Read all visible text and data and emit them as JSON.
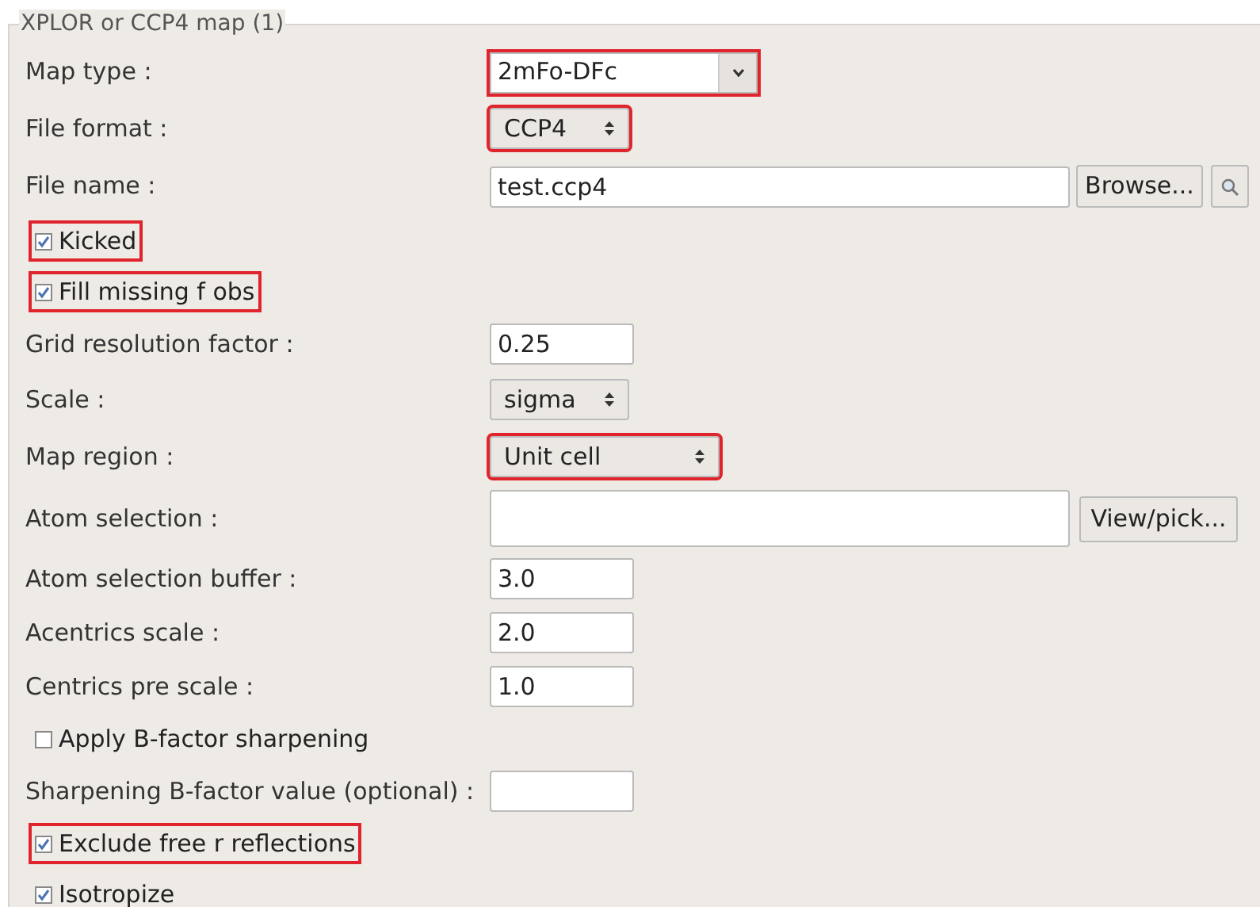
{
  "group": {
    "title": "XPLOR or CCP4 map (1)"
  },
  "rows": [
    {
      "kind": "combo",
      "label": "Map type :",
      "value": "2mFo-DFc",
      "highlighted": true
    },
    {
      "kind": "select",
      "label": "File format :",
      "value": "CCP4",
      "highlighted": true
    },
    {
      "kind": "file",
      "label": "File name :",
      "value": "test.ccp4",
      "button": "Browse...",
      "highlighted": false
    },
    {
      "kind": "checkbox",
      "label": "Kicked",
      "checked": true,
      "highlighted": true
    },
    {
      "kind": "checkbox",
      "label": "Fill missing f obs",
      "checked": true,
      "highlighted": true
    },
    {
      "kind": "text",
      "label": "Grid resolution factor :",
      "value": "0.25",
      "highlighted": false
    },
    {
      "kind": "select",
      "label": "Scale :",
      "value": "sigma",
      "highlighted": false
    },
    {
      "kind": "select_wide",
      "label": "Map region :",
      "value": "Unit cell",
      "highlighted": true
    },
    {
      "kind": "pick",
      "label": "Atom selection :",
      "button": "View/pick...",
      "highlighted": false
    },
    {
      "kind": "text",
      "label": "Atom selection buffer :",
      "value": "3.0",
      "highlighted": false
    },
    {
      "kind": "text",
      "label": "Acentrics scale :",
      "value": "2.0",
      "highlighted": false
    },
    {
      "kind": "text",
      "label": "Centrics pre scale :",
      "value": "1.0",
      "highlighted": false
    },
    {
      "kind": "checkbox",
      "label": "Apply B-factor sharpening",
      "checked": false,
      "highlighted": false
    },
    {
      "kind": "text",
      "label": "Sharpening B-factor value (optional) :",
      "highlighted": false
    },
    {
      "kind": "checkbox",
      "label": "Exclude free r reflections",
      "checked": true,
      "highlighted": true
    },
    {
      "kind": "checkbox",
      "label": "Isotropize",
      "checked": true,
      "highlighted": false
    }
  ]
}
